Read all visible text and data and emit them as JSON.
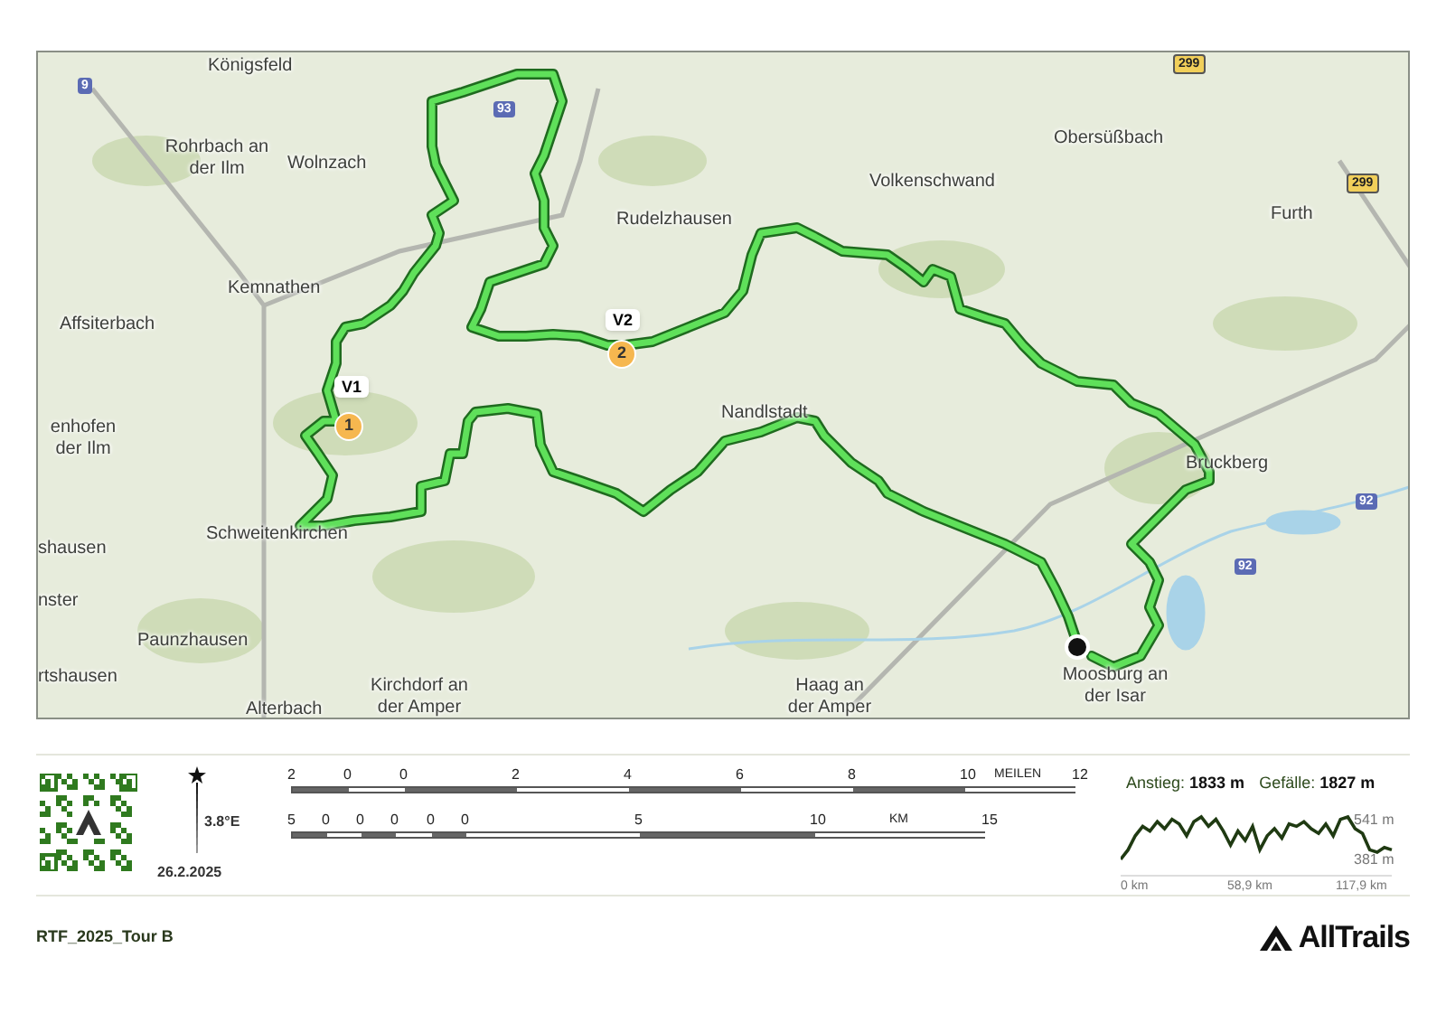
{
  "map": {
    "places": [
      {
        "name": "Königsfeld"
      },
      {
        "name": "Rohrbach an der Ilm"
      },
      {
        "name": "Wolnzach"
      },
      {
        "name": "Kemnathen"
      },
      {
        "name": "Affsiterbach"
      },
      {
        "name": "Rudelzhausen"
      },
      {
        "name": "Volkenschwand"
      },
      {
        "name": "Obersüßbach"
      },
      {
        "name": "Furth"
      },
      {
        "name": "Nandlstadt"
      },
      {
        "name": "Bruckberg"
      },
      {
        "name": "Moosburg an der Isar"
      },
      {
        "name": "Kirchdorf an der Amper"
      },
      {
        "name": "Haag an der Amper"
      },
      {
        "name": "Schweitenkirchen"
      },
      {
        "name": "enhofen der Ilm"
      },
      {
        "name": "shausen"
      },
      {
        "name": "nster"
      },
      {
        "name": "Paunzhausen"
      },
      {
        "name": "rtshausen"
      },
      {
        "name": "Alterbach"
      }
    ],
    "road_shields": [
      {
        "number": "9",
        "kind": "motorway"
      },
      {
        "number": "93",
        "kind": "motorway"
      },
      {
        "number": "299",
        "kind": "federal"
      },
      {
        "number": "299",
        "kind": "federal"
      },
      {
        "number": "92",
        "kind": "motorway"
      },
      {
        "number": "92",
        "kind": "motorway"
      }
    ],
    "waypoints": [
      {
        "label": "V1",
        "number": "1"
      },
      {
        "label": "V2",
        "number": "2"
      }
    ]
  },
  "legend": {
    "compass": {
      "declination": "3.8°E",
      "date": "26.2.2025"
    },
    "scale_miles": {
      "ticks": [
        "2",
        "0",
        "0",
        "2",
        "4",
        "6",
        "8",
        "10",
        "12"
      ],
      "unit": "MEILEN"
    },
    "scale_km": {
      "ticks": [
        "5",
        "0",
        "0",
        "0",
        "0",
        "0",
        "5",
        "10",
        "15"
      ],
      "unit": "KM"
    },
    "elevation": {
      "ascent_label": "Anstieg:",
      "ascent": "1833 m",
      "descent_label": "Gefälle:",
      "descent": "1827 m",
      "max": "541 m",
      "min": "381 m",
      "distance_labels": [
        "0 km",
        "58,9 km",
        "117,9 km"
      ]
    }
  },
  "footer": {
    "title": "RTF_2025_Tour B",
    "brand": "AllTrails"
  }
}
